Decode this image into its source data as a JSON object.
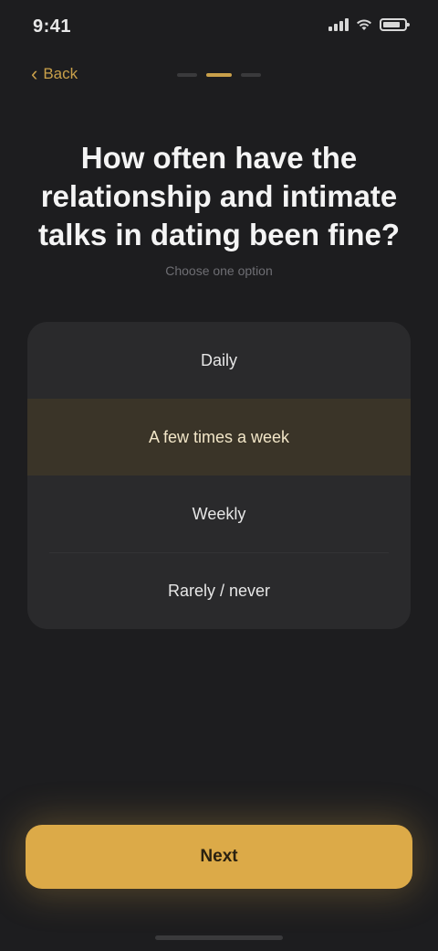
{
  "status_bar": {
    "time": "9:41",
    "battery_level": 0.8
  },
  "nav": {
    "back_label": "Back",
    "progress_total": 3,
    "progress_current": 2
  },
  "question": {
    "title": "How often have the relationship and intimate talks in dating been fine?",
    "subtitle": "Choose one option"
  },
  "options": [
    {
      "label": "Daily",
      "selected": false
    },
    {
      "label": "A few times a week",
      "selected": true
    },
    {
      "label": "Weekly",
      "selected": false
    },
    {
      "label": "Rarely / never",
      "selected": false
    }
  ],
  "footer": {
    "continue_label": "Next"
  },
  "colors": {
    "accent": "#dcaa48",
    "background": "#1d1d1f",
    "card": "#2a2a2c"
  },
  "icons": [
    "signal-icon",
    "wifi-icon",
    "battery-icon",
    "chevron-left-icon"
  ]
}
